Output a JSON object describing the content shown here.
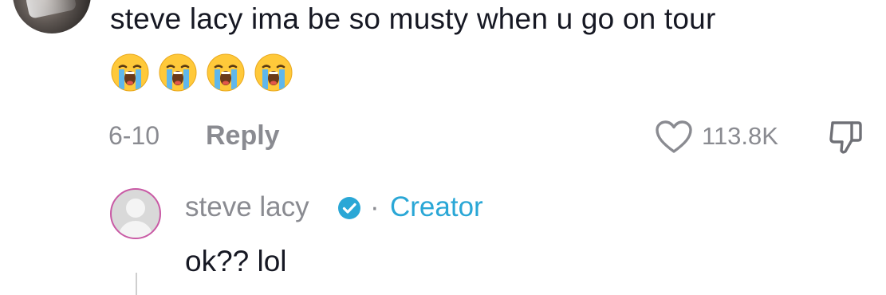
{
  "comment": {
    "text": "steve lacy ima be so musty when u go on tour",
    "emojis": [
      "loudly-crying-face",
      "loudly-crying-face",
      "loudly-crying-face",
      "loudly-crying-face"
    ],
    "date": "6-10",
    "reply_label": "Reply",
    "likes": "113.8K"
  },
  "reply": {
    "author": "steve lacy",
    "separator": "·",
    "creator_label": "Creator",
    "text": "ok?? lol"
  },
  "colors": {
    "text": "#161823",
    "muted": "#8a8b91",
    "creator": "#2aa7d6",
    "verified": "#2aa7d6",
    "avatar_ring": "#c95aa5"
  }
}
